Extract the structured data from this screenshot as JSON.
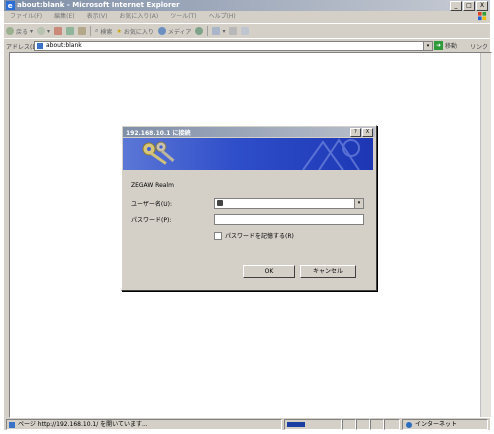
{
  "window": {
    "title": "about:blank - Microsoft Internet Explorer",
    "controls": [
      "_",
      "□",
      "X"
    ]
  },
  "menu": [
    "ファイル(F)",
    "編集(E)",
    "表示(V)",
    "お気に入り(A)",
    "ツール(T)",
    "ヘルプ(H)"
  ],
  "toolbar": {
    "back": "戻る",
    "search": "検索",
    "favorites": "お気に入り",
    "media": "メディア"
  },
  "address": {
    "label": "アドレス(D)",
    "url": "about:blank",
    "go": "移動",
    "links": "リンク"
  },
  "dialog": {
    "title": "192.168.10.1 に接続",
    "help_btn": "?",
    "close_btn": "X",
    "realm": "ZEGAW Realm",
    "username_label": "ユーザー名(U):",
    "password_label": "パスワード(P):",
    "remember_label": "パスワードを記憶する(R)",
    "ok_button": "OK",
    "cancel_button": "キャンセル"
  },
  "status": {
    "text": "ページ http://192.168.10.1/ を開いています...",
    "zone": "インターネット",
    "progress": 0.32
  },
  "colors": {
    "chrome": "#d4d0c8",
    "banner": "#2f4ec9",
    "progress": "#1a3fa0"
  }
}
